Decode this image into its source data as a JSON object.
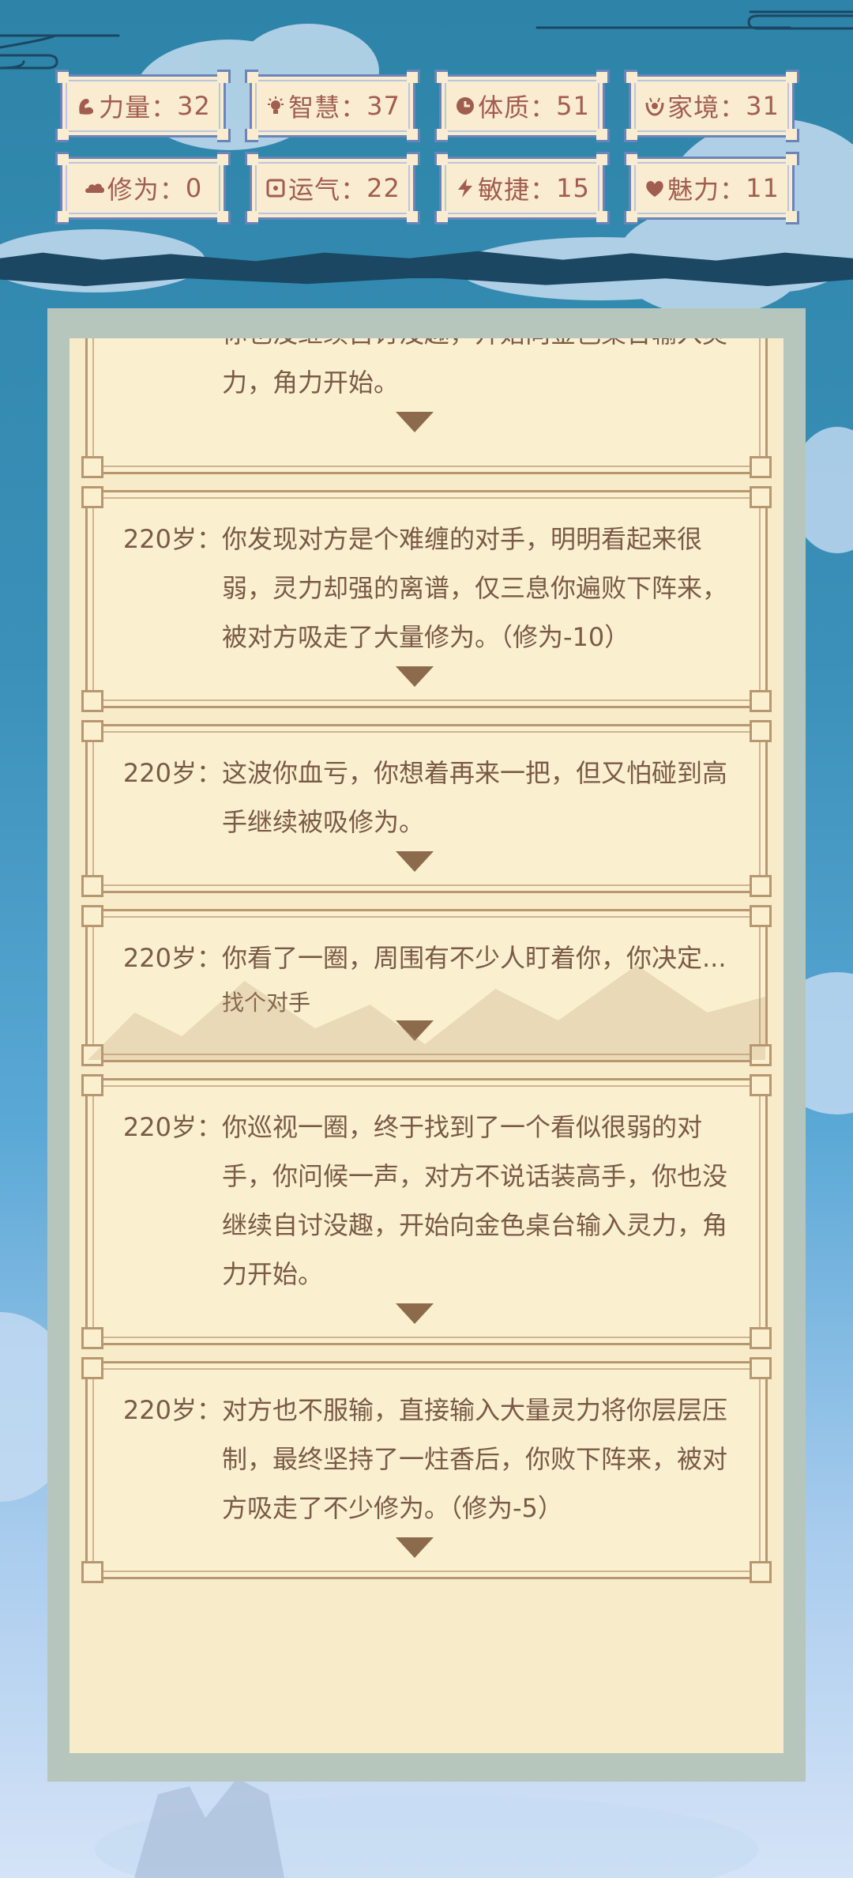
{
  "stats": [
    {
      "label": "力量",
      "sep": "：",
      "value": "32",
      "icon": "muscle-icon"
    },
    {
      "label": "智慧",
      "sep": "：",
      "value": "37",
      "icon": "lightbulb-icon"
    },
    {
      "label": "体质",
      "sep": "：",
      "value": "51",
      "icon": "health-icon"
    },
    {
      "label": "家境",
      "sep": "：",
      "value": "31",
      "icon": "family-icon"
    },
    {
      "label": "修为",
      "sep": "：",
      "value": "0",
      "icon": "cloud-icon"
    },
    {
      "label": "运气",
      "sep": "：",
      "value": "22",
      "icon": "dice-icon"
    },
    {
      "label": "敏捷",
      "sep": "：",
      "value": "15",
      "icon": "lightning-icon"
    },
    {
      "label": "魅力",
      "sep": "：",
      "value": "11",
      "icon": "heart-icon"
    }
  ],
  "events": [
    {
      "age": "",
      "text": "你也没继续自讨没趣，开始向金色桌台输入灵力，角力开始。",
      "choice": ""
    },
    {
      "age": "220岁：",
      "text": "你发现对方是个难缠的对手，明明看起来很弱，灵力却强的离谱，仅三息你遍败下阵来，被对方吸走了大量修为。（修为-10）",
      "choice": ""
    },
    {
      "age": "220岁：",
      "text": "这波你血亏，你想着再来一把，但又怕碰到高手继续被吸修为。",
      "choice": ""
    },
    {
      "age": "220岁：",
      "text": "你看了一圈，周围有不少人盯着你，你决定...",
      "choice": "找个对手"
    },
    {
      "age": "220岁：",
      "text": "你巡视一圈，终于找到了一个看似很弱的对手，你问候一声，对方不说话装高手，你也没继续自讨没趣，开始向金色桌台输入灵力，角力开始。",
      "choice": ""
    },
    {
      "age": "220岁：",
      "text": "对方也不服输，直接输入大量灵力将你层层压制，最终坚持了一炷香后，你败下阵来，被对方吸走了不少修为。（修为-5）",
      "choice": ""
    }
  ],
  "colors": {
    "stat_text": "#a15d4f",
    "stat_border": "#6c84b8",
    "card_bg": "#faf0cf",
    "card_text": "#7a5a45",
    "arrow": "#8c6b4c"
  }
}
